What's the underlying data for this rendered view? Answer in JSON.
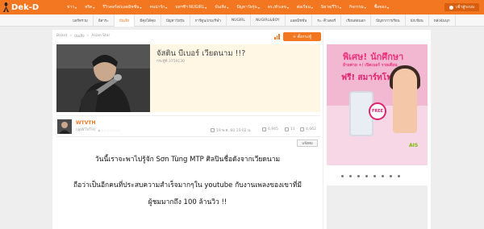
{
  "brand": {
    "logo": "Dek-D",
    "accent": "#f37721"
  },
  "topnav": [
    {
      "label": "ข่าว",
      "caret": "▾"
    },
    {
      "label": "ทริค",
      "caret": "▾"
    },
    {
      "label": "รีวิวคอร์ส/แอดมิชชั่น",
      "caret": "▾"
    },
    {
      "label": "คนน่ารัก",
      "caret": "▾"
    },
    {
      "label": "บทฯซีฯ NUGIRL",
      "caret": "▾"
    },
    {
      "label": "บันเทิง",
      "caret": "▾"
    },
    {
      "label": "ปัญหาวัยรุ่น",
      "caret": "▾"
    },
    {
      "label": "จร./ตัวเลข",
      "caret": "▾"
    },
    {
      "label": "ต่อเรียน",
      "caret": "▾"
    },
    {
      "label": "นิยาย/รีวิว",
      "caret": "▾"
    },
    {
      "label": "กิจกรรม",
      "caret": "▾"
    },
    {
      "label": "ซื้อของ",
      "caret": "▾"
    }
  ],
  "login_label": "เข้าสู่ระบบ",
  "subnav": [
    {
      "label": "บอร์ดรวม",
      "active": false
    },
    {
      "label": "อีสาระ",
      "active": false
    },
    {
      "label": "บันเทิง",
      "active": true
    },
    {
      "label": "มีคุยได้คุย",
      "active": false
    },
    {
      "label": "ปัญหาวัยรุ่น",
      "active": false
    },
    {
      "label": "การ์ตูน/เกม/กีฬา",
      "active": false
    },
    {
      "label": "NUGIRL",
      "active": false
    },
    {
      "label": "NUGIRL&BOY",
      "active": false
    },
    {
      "label": "แอดมิชชั่น",
      "active": false
    },
    {
      "label": "ระ.-ติวเตอร์",
      "active": false
    },
    {
      "label": "เรียนต่อนอก",
      "active": false
    },
    {
      "label": "ปัญหาการเรียน",
      "active": false
    },
    {
      "label": "นักเขียน",
      "active": false
    },
    {
      "label": "หลังฉันนุก",
      "active": false
    }
  ],
  "breadcrumb": [
    "Board",
    "»",
    "บันเทิง",
    "»",
    "Asian Star"
  ],
  "follow_label": "+ ตั้งกระทู้",
  "post": {
    "title": "จัสติน บีเบอร์ เวียดนาม !!?",
    "id_text": "กระทู้ที่ 3759130",
    "author": "WTVTH",
    "handle": "(@WTVTH)",
    "stars": "●○○○○○○○",
    "date": "19 พ.ค. 60 15:02 น.",
    "views": "6,945",
    "comments": "11",
    "likes": "4,662",
    "button_label": "แจ้งลบ",
    "paragraphs": [
      "วันนี้เราจะพาไปรู้จัก Sơn Tùng MTP ศิลปินชื่อดังจากเวียดนาม",
      "ถือว่าเป็นอีกคนที่ประสบความสำเร็จมากๆใน youtube กับงานเพลงของเขาที่มี",
      "ผู้ชมมากถึง 100 ล้านวิว !!"
    ]
  },
  "ad": {
    "title": "พิเศษ! นักศึกษา",
    "line": "ย้ายค่าย +/ เปิดเบอร์ รายเดือน",
    "free": "ฟรี! สมาร์ทโฟน",
    "badge": "FREE",
    "brand": "AIS"
  }
}
